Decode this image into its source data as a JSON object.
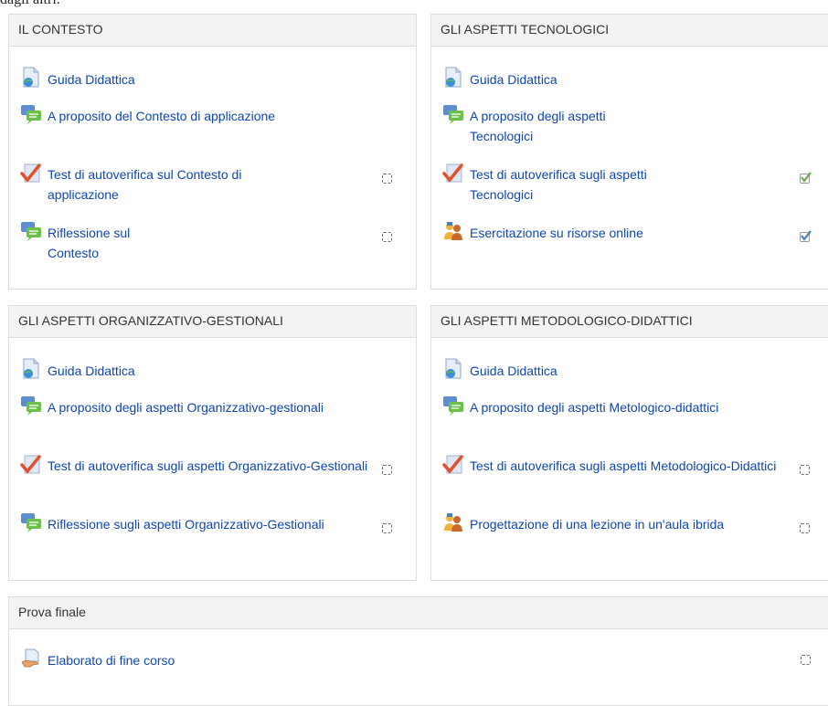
{
  "intro_text": "dagli altri.",
  "sections": [
    {
      "title": "IL CONTESTO",
      "items": [
        {
          "label": "Guida Didattica",
          "icon": "page-icon",
          "check": null
        },
        {
          "label": "A proposito del Contesto di applicazione",
          "icon": "forum-icon",
          "check": null
        },
        {
          "label": "Test di autoverifica sul Contesto di applicazione",
          "icon": "quiz-icon",
          "check": "empty"
        },
        {
          "label": "Riflessione sul Contesto",
          "icon": "forum-icon",
          "check": "empty"
        }
      ]
    },
    {
      "title": "GLI ASPETTI TECNOLOGICI",
      "items": [
        {
          "label": "Guida Didattica",
          "icon": "page-icon",
          "check": null
        },
        {
          "label": "A proposito degli aspetti Tecnologici",
          "icon": "forum-icon",
          "check": null
        },
        {
          "label": "Test di autoverifica sugli aspetti Tecnologici",
          "icon": "quiz-icon",
          "check": "done-green"
        },
        {
          "label": "Esercitazione su risorse online",
          "icon": "workshop-icon",
          "check": "done-blue"
        }
      ]
    },
    {
      "title": "GLI ASPETTI ORGANIZZATIVO-GESTIONALI",
      "items": [
        {
          "label": "Guida Didattica",
          "icon": "page-icon",
          "check": null
        },
        {
          "label": "A proposito degli aspetti Organizzativo-gestionali",
          "icon": "forum-icon",
          "check": null
        },
        {
          "label": "Test di autoverifica sugli aspetti Organizzativo-Gestionali",
          "icon": "quiz-icon",
          "check": "empty"
        },
        {
          "label": "Riflessione sugli aspetti Organizzativo-Gestionali",
          "icon": "forum-icon",
          "check": "empty"
        }
      ]
    },
    {
      "title": "GLI ASPETTI METODOLOGICO-DIDATTICI",
      "items": [
        {
          "label": "Guida Didattica",
          "icon": "page-icon",
          "check": null
        },
        {
          "label": "A proposito degli aspetti Metologico-didattici",
          "icon": "forum-icon",
          "check": null
        },
        {
          "label": "Test di autoverifica sugli aspetti Metodologico-Didattici",
          "icon": "quiz-icon",
          "check": "empty"
        },
        {
          "label": "Progettazione di una lezione in un'aula ibrida",
          "icon": "workshop-icon",
          "check": "empty"
        }
      ]
    },
    {
      "title": "Prova finale",
      "items": [
        {
          "label": "Elaborato di fine corso",
          "icon": "assignment-icon",
          "check": "empty"
        }
      ]
    }
  ],
  "colors": {
    "link": "#0f47ad",
    "header_bg": "#f3f3f3",
    "check_green": "#6aa84f",
    "check_blue": "#4a7fc1"
  }
}
